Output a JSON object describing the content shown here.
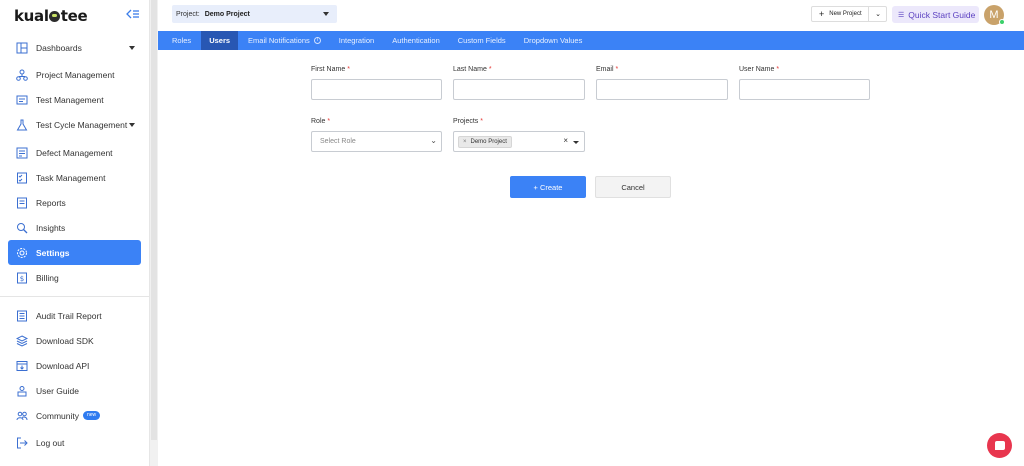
{
  "brand": {
    "logo_text_left": "kual",
    "logo_text_right": "tee"
  },
  "sidebar": {
    "items": [
      {
        "label": "Dashboards",
        "icon": "dashboard-icon",
        "has_caret": true
      },
      {
        "label": "Project Management",
        "icon": "project-icon"
      },
      {
        "label": "Test Management",
        "icon": "test-icon"
      },
      {
        "label": "Test Cycle Management",
        "icon": "flask-icon",
        "has_caret": true
      },
      {
        "label": "Defect Management",
        "icon": "defect-icon"
      },
      {
        "label": "Task Management",
        "icon": "task-icon"
      },
      {
        "label": "Reports",
        "icon": "reports-icon"
      },
      {
        "label": "Insights",
        "icon": "insights-icon"
      },
      {
        "label": "Settings",
        "icon": "gear-icon",
        "active": true
      },
      {
        "label": "Billing",
        "icon": "billing-icon"
      }
    ],
    "bottom_items": [
      {
        "label": "Audit Trail Report",
        "icon": "audit-icon"
      },
      {
        "label": "Download SDK",
        "icon": "sdk-icon"
      },
      {
        "label": "Download API",
        "icon": "api-icon"
      },
      {
        "label": "User Guide",
        "icon": "guide-icon"
      },
      {
        "label": "Community",
        "icon": "community-icon",
        "badge": "new"
      },
      {
        "label": "Log out",
        "icon": "logout-icon"
      }
    ]
  },
  "header": {
    "project_label": "Project:",
    "project_value": "Demo Project",
    "new_project": "New Project",
    "quick_start": "Quick Start Guide",
    "avatar_initial": "M"
  },
  "tabs": [
    {
      "label": "Roles"
    },
    {
      "label": "Users",
      "active": true
    },
    {
      "label": "Email Notifications",
      "info": true
    },
    {
      "label": "Integration"
    },
    {
      "label": "Authentication"
    },
    {
      "label": "Custom Fields"
    },
    {
      "label": "Dropdown Values"
    }
  ],
  "form": {
    "first_name_label": "First Name",
    "last_name_label": "Last Name",
    "email_label": "Email",
    "user_name_label": "User Name",
    "role_label": "Role",
    "role_placeholder": "Select Role",
    "projects_label": "Projects",
    "projects_chip": "Demo Project",
    "required_mark": "*",
    "create_button": "+ Create",
    "cancel_button": "Cancel"
  },
  "colors": {
    "accent": "#3b82f6",
    "active_tab": "#2857b3",
    "chat": "#e8364e"
  }
}
